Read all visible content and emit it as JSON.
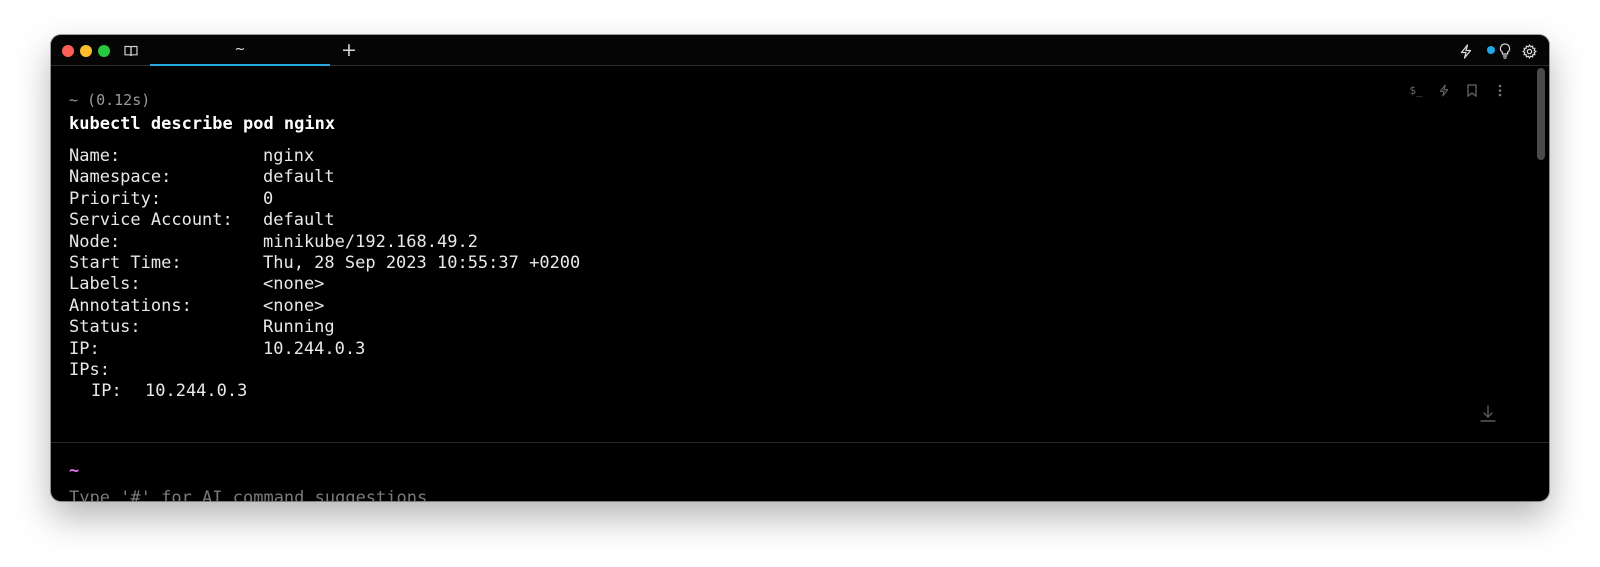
{
  "tabs": [
    {
      "label": "~",
      "active": true
    }
  ],
  "titlebar": {
    "left_icon": "book-icon",
    "new_tab_label": "+",
    "right_icons": [
      "lightning-icon",
      "status-dot-icon",
      "lightbulb-icon",
      "gear-icon"
    ],
    "accent_color": "#28a8e0"
  },
  "block": {
    "meta": "~ (0.12s)",
    "command": "kubectl describe pod nginx",
    "tools": [
      "$_",
      "lightning-icon",
      "bookmark-icon",
      "more-vertical-icon"
    ],
    "output": [
      {
        "key": "Name:",
        "value": "nginx"
      },
      {
        "key": "Namespace:",
        "value": "default"
      },
      {
        "key": "Priority:",
        "value": "0"
      },
      {
        "key": "Service Account:",
        "value": "default"
      },
      {
        "key": "Node:",
        "value": "minikube/192.168.49.2"
      },
      {
        "key": "Start Time:",
        "value": "Thu, 28 Sep 2023 10:55:37 +0200"
      },
      {
        "key": "Labels:",
        "value": "<none>"
      },
      {
        "key": "Annotations:",
        "value": "<none>"
      },
      {
        "key": "Status:",
        "value": "Running"
      },
      {
        "key": "IP:",
        "value": "10.244.0.3"
      },
      {
        "key": "IPs:",
        "value": ""
      },
      {
        "key": "IP:",
        "value": "10.244.0.3",
        "nested": true
      }
    ]
  },
  "input": {
    "prompt_dir": "~",
    "placeholder": "Type '#' for AI command suggestions",
    "value": "",
    "prompt_color": "#e26ef0"
  }
}
